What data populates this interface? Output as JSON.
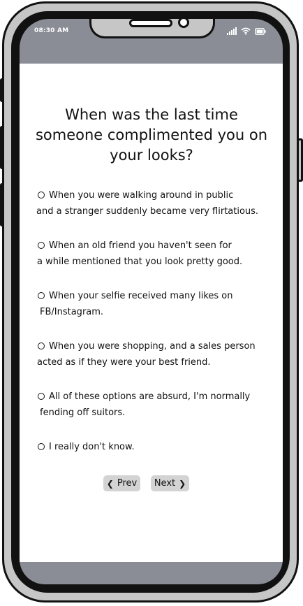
{
  "status_bar": {
    "time": "08:30 AM",
    "icons": [
      "signal-icon",
      "wifi-icon",
      "battery-icon"
    ]
  },
  "question": {
    "lines": [
      "When was the last time",
      "someone complimented you on",
      "your looks?"
    ]
  },
  "options": [
    {
      "lines": [
        "When you were walking around in public",
        "and a stranger suddenly became very flirtatious."
      ]
    },
    {
      "lines": [
        "When an old friend you haven't seen for",
        "a while mentioned that you look pretty good."
      ]
    },
    {
      "lines": [
        "When your selfie received many likes on",
        "FB/Instagram."
      ]
    },
    {
      "lines": [
        "When you were shopping, and a sales person",
        "acted as if they were your best friend."
      ]
    },
    {
      "lines": [
        "All of these options are absurd, I'm normally",
        "fending off suitors."
      ]
    },
    {
      "lines": [
        "I really don't know."
      ]
    }
  ],
  "navigation": {
    "prev_label": "Prev",
    "next_label": "Next"
  },
  "colors": {
    "phone_frame": "#c6c6c6",
    "screen_chrome": "#8a8d96",
    "button_bg": "#d3d3d3"
  }
}
